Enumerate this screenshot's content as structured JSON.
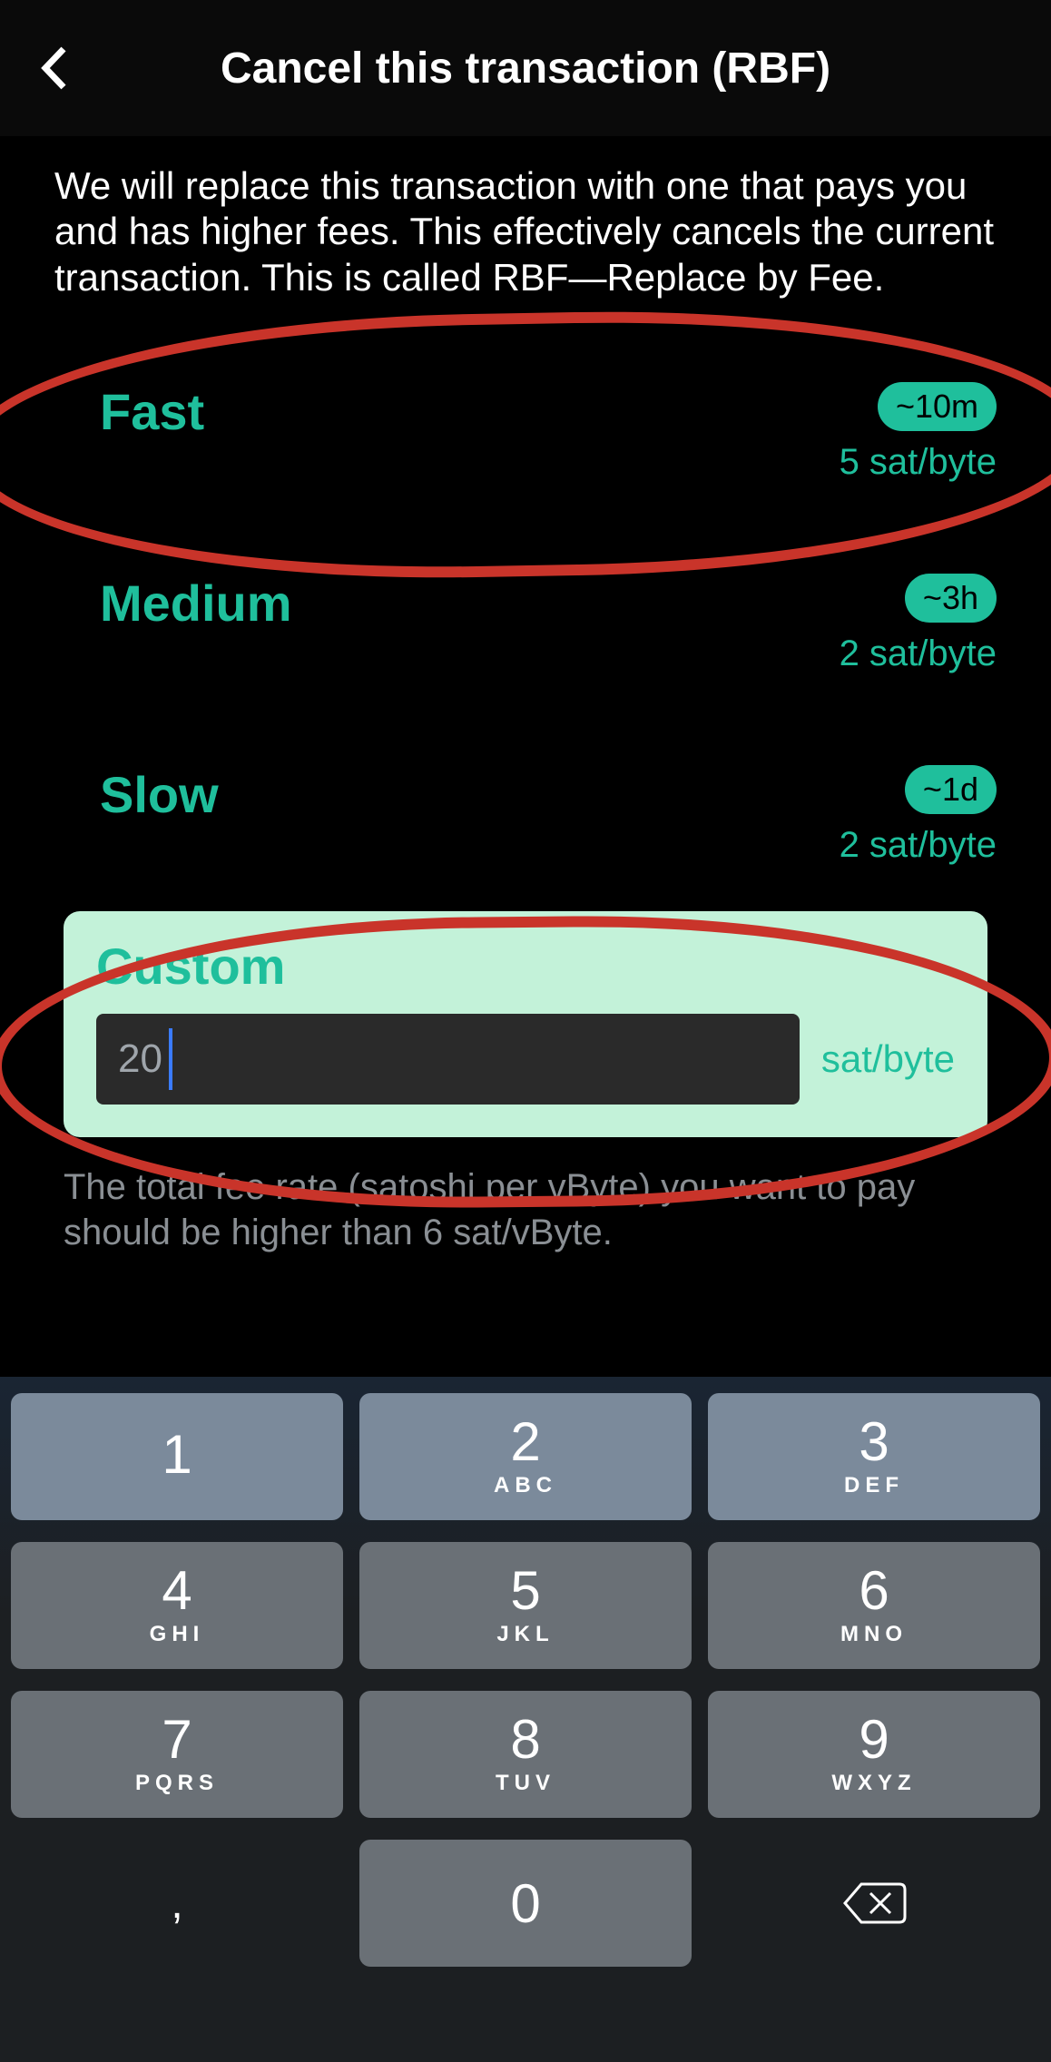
{
  "header": {
    "title": "Cancel this transaction (RBF)"
  },
  "description": "We will replace this transaction with one that pays you and has higher fees. This effectively cancels the current transaction. This is called RBF—Replace by Fee.",
  "fee_options": [
    {
      "label": "Fast",
      "time": "~10m",
      "rate": "5 sat/byte"
    },
    {
      "label": "Medium",
      "time": "~3h",
      "rate": "2 sat/byte"
    },
    {
      "label": "Slow",
      "time": "~1d",
      "rate": "2 sat/byte"
    }
  ],
  "custom": {
    "label": "Custom",
    "value": "20",
    "unit": "sat/byte"
  },
  "hint": "The total fee rate (satoshi per vByte) you want to pay should be higher than 6 sat/vByte.",
  "keyboard": {
    "rows": [
      [
        {
          "n": "1",
          "s": ""
        },
        {
          "n": "2",
          "s": "ABC"
        },
        {
          "n": "3",
          "s": "DEF"
        }
      ],
      [
        {
          "n": "4",
          "s": "GHI"
        },
        {
          "n": "5",
          "s": "JKL"
        },
        {
          "n": "6",
          "s": "MNO"
        }
      ],
      [
        {
          "n": "7",
          "s": "PQRS"
        },
        {
          "n": "8",
          "s": "TUV"
        },
        {
          "n": "9",
          "s": "WXYZ"
        }
      ]
    ],
    "comma": ",",
    "zero": "0"
  }
}
